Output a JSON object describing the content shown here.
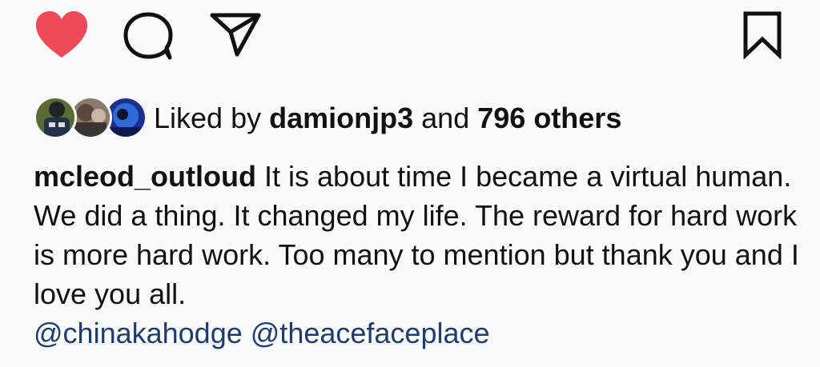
{
  "actions": {
    "like_icon": "heart-filled-icon",
    "like_color": "#ed4956",
    "comment_icon": "comment-bubble-icon",
    "share_icon": "paper-plane-icon",
    "save_icon": "bookmark-icon"
  },
  "likes": {
    "prefix": "Liked by",
    "first_user": "damionjp3",
    "conjunction": "and",
    "others": "796 others"
  },
  "caption": {
    "username": "mcleod_outloud",
    "text": "It is about time I became a virtual human. We did a thing. It changed my life. The reward for hard work is more hard work. Too many to mention but thank you and I love you all."
  },
  "mentions": [
    "@chinakahodge",
    "@theacefaceplace"
  ],
  "colors": {
    "background": "#fafafa",
    "text": "#111111",
    "mention": "#1c3d6e"
  }
}
